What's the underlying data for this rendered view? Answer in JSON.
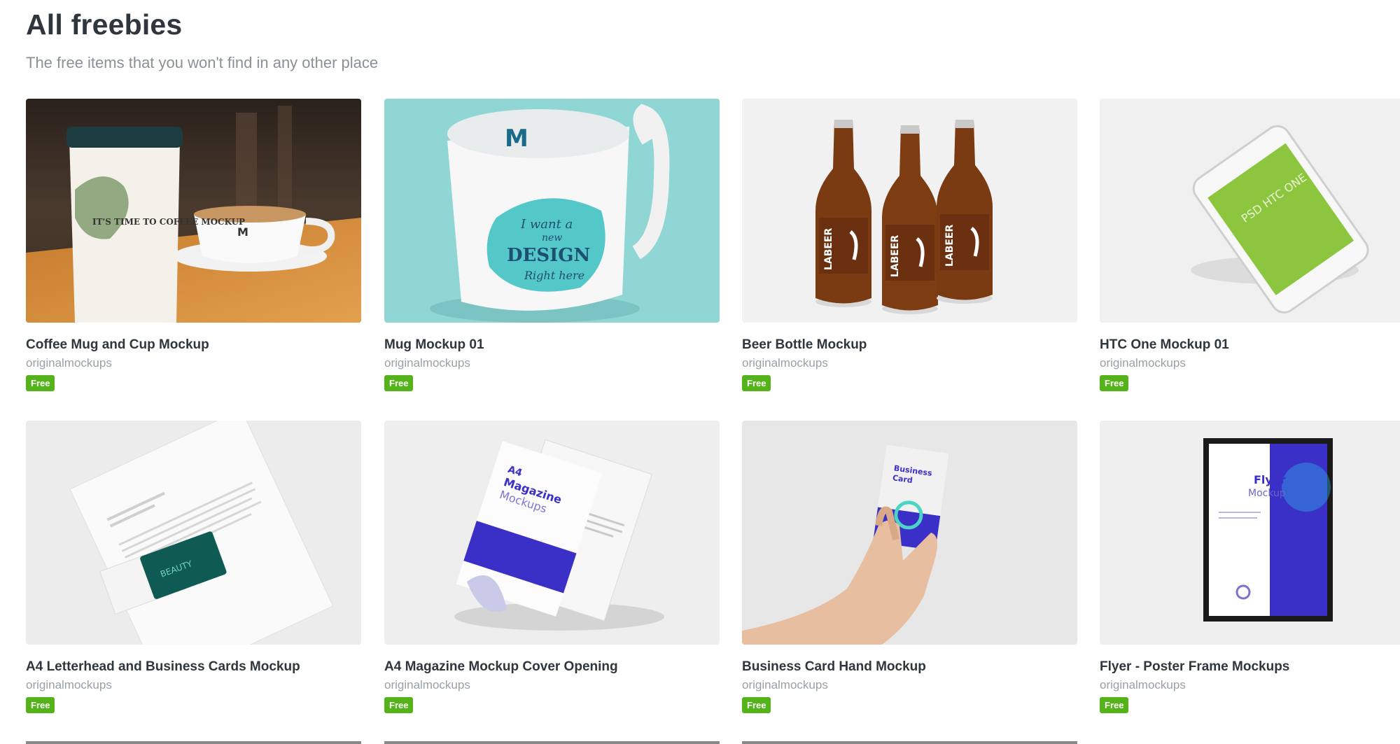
{
  "header": {
    "title": "All freebies",
    "subtitle": "The free items that you won't find in any other place"
  },
  "items": [
    {
      "title": "Coffee Mug and Cup Mockup",
      "author": "originalmockups",
      "badge": "Free",
      "thumb_icon": "coffee-cup-image",
      "mug_text": "IT'S TIME TO COFFEE MOCKUP",
      "mug_logo": "M"
    },
    {
      "title": "Mug Mockup 01",
      "author": "originalmockups",
      "badge": "Free",
      "thumb_icon": "mug-image",
      "mug_logo": "M",
      "design_text_1": "I want a",
      "design_text_2": "new",
      "design_text_3": "DESIGN",
      "design_text_4": "Right here"
    },
    {
      "title": "Beer Bottle Mockup",
      "author": "originalmockups",
      "badge": "Free",
      "thumb_icon": "beer-bottles-image",
      "label_text": "LABEER"
    },
    {
      "title": "HTC One Mockup 01",
      "author": "originalmockups",
      "badge": "Free",
      "thumb_icon": "smartphone-image",
      "screen_text": "PSD HTC ONE"
    },
    {
      "title": "A4 Letterhead and Business Cards Mockup",
      "author": "originalmockups",
      "badge": "Free",
      "thumb_icon": "letterhead-image",
      "card_text": "BEAUTY"
    },
    {
      "title": "A4 Magazine Mockup Cover Opening",
      "author": "originalmockups",
      "badge": "Free",
      "thumb_icon": "magazine-image",
      "cover_text_1": "A4",
      "cover_text_2": "Magazine",
      "cover_text_3": "Mockups"
    },
    {
      "title": "Business Card Hand Mockup",
      "author": "originalmockups",
      "badge": "Free",
      "thumb_icon": "hand-card-image",
      "card_text_1": "Business",
      "card_text_2": "Card"
    },
    {
      "title": "Flyer - Poster Frame Mockups",
      "author": "originalmockups",
      "badge": "Free",
      "thumb_icon": "poster-frame-image",
      "poster_text_1": "Flyer",
      "poster_text_2": "Mockup"
    }
  ],
  "colors": {
    "badge": "#55b31a",
    "mug_bg": "#8fd6d5",
    "beer": "#7a3a12",
    "phone_screen": "#8cc63f",
    "accent_blue": "#3a30c8"
  }
}
